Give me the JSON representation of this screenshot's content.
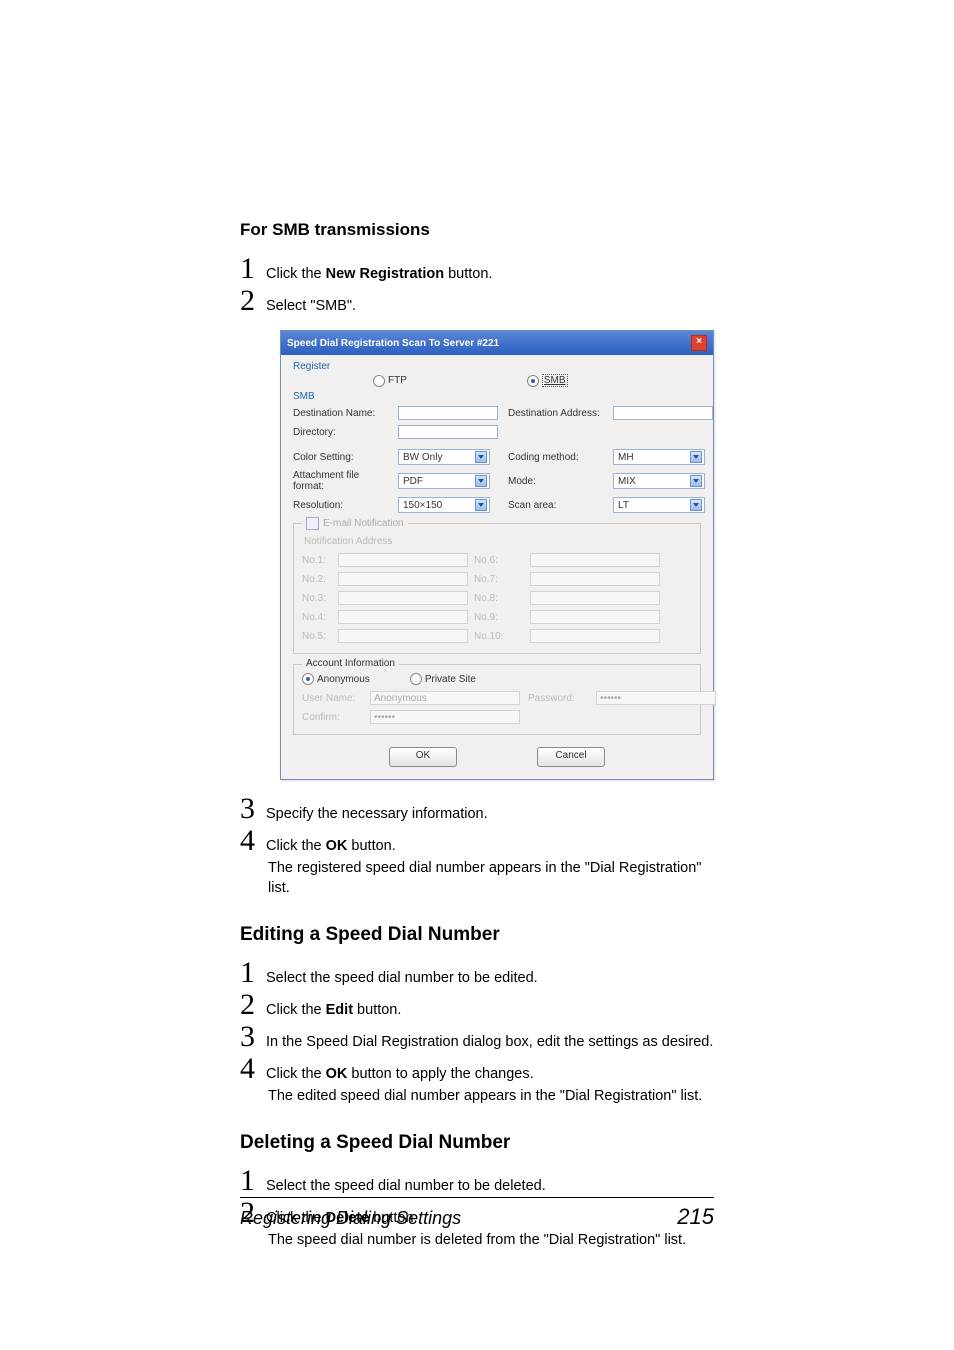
{
  "sec_smb": {
    "heading": "For SMB transmissions",
    "steps12": [
      {
        "num": "1",
        "pre": "Click the ",
        "bold": "New Registration",
        "post": " button."
      },
      {
        "num": "2",
        "pre": "Select \"SMB\"."
      }
    ],
    "steps34": {
      "s3": {
        "num": "3",
        "text": "Specify the necessary information."
      },
      "s4": {
        "num": "4",
        "pre": "Click the ",
        "bold": "OK",
        "post": " button."
      },
      "s4_sub": "The registered speed dial number appears in the \"Dial Registration\" list."
    }
  },
  "dialog": {
    "title": "Speed Dial Registration Scan To Server #221",
    "register_label": "Register",
    "radio_ftp": "FTP",
    "radio_smb": "SMB",
    "smb_header": "SMB",
    "fields": {
      "dest_name": "Destination Name:",
      "dest_addr": "Destination Address:",
      "directory": "Directory:",
      "color": "Color Setting:",
      "color_val": "BW Only",
      "coding": "Coding method:",
      "coding_val": "MH",
      "attach": "Attachment file format:",
      "attach_val": "PDF",
      "mode": "Mode:",
      "mode_val": "MIX",
      "reso": "Resolution:",
      "reso_val": "150×150",
      "scan": "Scan area:",
      "scan_val": "LT"
    },
    "notif": {
      "legend": "E-mail Notification",
      "addr": "Notification Address",
      "n": [
        "No.1:",
        "No.2:",
        "No.3:",
        "No.4:",
        "No.5:",
        "No.6:",
        "No.7:",
        "No.8:",
        "No.9:",
        "No.10:"
      ]
    },
    "acct": {
      "legend": "Account Information",
      "anon": "Anonymous",
      "priv": "Private Site",
      "user": "User Name:",
      "user_val": "Anonymous",
      "pass": "Password:",
      "pass_val": "••••••",
      "conf": "Confirm:",
      "conf_val": "••••••"
    },
    "ok": "OK",
    "cancel": "Cancel"
  },
  "sec_edit": {
    "heading": "Editing a Speed Dial Number",
    "s1": {
      "num": "1",
      "text": "Select the speed dial number to be edited."
    },
    "s2": {
      "num": "2",
      "pre": "Click the ",
      "bold": "Edit",
      "post": " button."
    },
    "s3": {
      "num": "3",
      "text": "In the Speed Dial Registration dialog box, edit the settings as desired."
    },
    "s4": {
      "num": "4",
      "pre": "Click the ",
      "bold": "OK",
      "post": " button to apply the changes."
    },
    "s4_sub": "The edited speed dial number appears in the \"Dial Registration\" list."
  },
  "sec_del": {
    "heading": "Deleting a Speed Dial Number",
    "s1": {
      "num": "1",
      "text": "Select the speed dial number to be deleted."
    },
    "s2": {
      "num": "2",
      "pre": "Click the ",
      "bold": "Delete",
      "post": " button."
    },
    "s2_sub": "The speed dial number is deleted from the \"Dial Registration\" list."
  },
  "footer": {
    "title": "Registering Dialing Settings",
    "page": "215"
  }
}
